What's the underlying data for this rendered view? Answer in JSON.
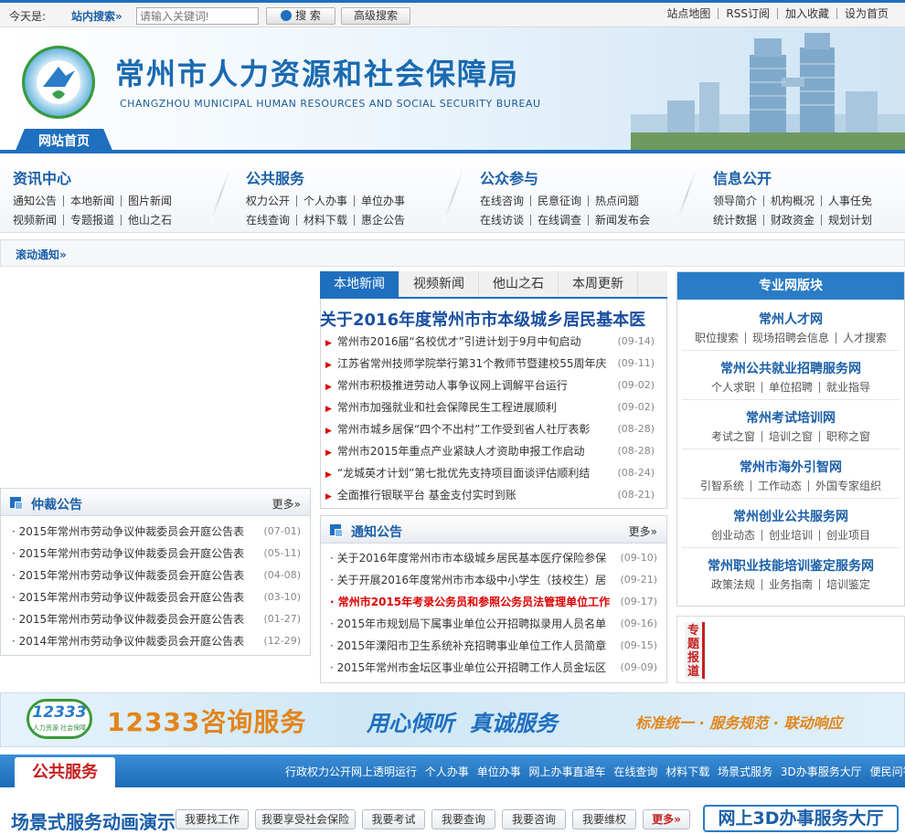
{
  "topbar": {
    "today_label": "今天是:",
    "search_label": "站内搜索",
    "search_placeholder": "请输入关键词!",
    "search_button": "搜 索",
    "advanced_button": "高级搜索",
    "links": [
      "站点地图",
      "RSS订阅",
      "加入收藏",
      "设为首页"
    ]
  },
  "banner": {
    "title": "常州市人力资源和社会保障局",
    "subtitle": "CHANGZHOU MUNICIPAL HUMAN RESOURCES AND SOCIAL SECURITY BUREAU",
    "home_tab": "网站首页"
  },
  "menus": [
    {
      "title": "资讯中心",
      "row1": [
        "通知公告",
        "本地新闻",
        "图片新闻"
      ],
      "row2": [
        "视频新闻",
        "专题报道",
        "他山之石"
      ]
    },
    {
      "title": "公共服务",
      "row1": [
        "权力公开",
        "个人办事",
        "单位办事"
      ],
      "row2": [
        "在线查询",
        "材料下载",
        "惠企公告"
      ]
    },
    {
      "title": "公众参与",
      "row1": [
        "在线咨询",
        "民意征询",
        "热点问题"
      ],
      "row2": [
        "在线访谈",
        "在线调查",
        "新闻发布会"
      ]
    },
    {
      "title": "信息公开",
      "row1": [
        "领导简介",
        "机构概况",
        "人事任免"
      ],
      "row2": [
        "统计数据",
        "财政资金",
        "规划计划"
      ]
    }
  ],
  "scroll_notice": "滚动通知",
  "arbitration": {
    "title": "仲裁公告",
    "more": "更多",
    "items": [
      {
        "text": "2015年常州市劳动争议仲裁委员会开庭公告表",
        "date": "(07-01)"
      },
      {
        "text": "2015年常州市劳动争议仲裁委员会开庭公告表",
        "date": "(05-11)"
      },
      {
        "text": "2015年常州市劳动争议仲裁委员会开庭公告表",
        "date": "(04-08)"
      },
      {
        "text": "2015年常州市劳动争议仲裁委员会开庭公告表",
        "date": "(03-10)"
      },
      {
        "text": "2015年常州市劳动争议仲裁委员会开庭公告表",
        "date": "(01-27)"
      },
      {
        "text": "2014年常州市劳动争议仲裁委员会开庭公告表",
        "date": "(12-29)"
      }
    ]
  },
  "news": {
    "tabs": [
      "本地新闻",
      "视频新闻",
      "他山之石",
      "本周更新"
    ],
    "headline": "关于2016年度常州市市本级城乡居民基本医",
    "items": [
      {
        "text": "常州市2016届“名校优才”引进计划于9月中旬启动",
        "date": "(09-14)"
      },
      {
        "text": "江苏省常州技师学院举行第31个教师节暨建校55周年庆",
        "date": "(09-11)"
      },
      {
        "text": "常州市积极推进劳动人事争议网上调解平台运行",
        "date": "(09-02)"
      },
      {
        "text": "常州市加强就业和社会保障民生工程进展顺利",
        "date": "(09-02)"
      },
      {
        "text": "常州市城乡居保“四个不出村”工作受到省人社厅表彰",
        "date": "(08-28)"
      },
      {
        "text": "常州市2015年重点产业紧缺人才资助申报工作启动",
        "date": "(08-28)"
      },
      {
        "text": "“龙城英才计划”第七批优先支持项目面谈评估顺利结",
        "date": "(08-24)"
      },
      {
        "text": "全面推行银联平台 基金支付实时到账",
        "date": "(08-21)"
      }
    ]
  },
  "notices": {
    "title": "通知公告",
    "more": "更多",
    "items": [
      {
        "text": "关于2016年度常州市市本级城乡居民基本医疗保险参保",
        "date": "(09-10)"
      },
      {
        "text": "关于开展2016年度常州市市本级中小学生（技校生）居",
        "date": "(09-21)"
      },
      {
        "text": "常州市2015年考录公务员和参照公务员法管理单位工作",
        "date": "(09-17)"
      },
      {
        "text": "2015年市规划局下属事业单位公开招聘拟录用人员名单",
        "date": "(09-16)"
      },
      {
        "text": "2015年溧阳市卫生系统补充招聘事业单位工作人员简章",
        "date": "(09-15)"
      },
      {
        "text": "2015年常州市金坛区事业单位公开招聘工作人员金坛区",
        "date": "(09-09)"
      }
    ]
  },
  "pro": {
    "title": "专业网版块",
    "items": [
      {
        "name": "常州人才网",
        "links": [
          "职位搜索",
          "现场招聘会信息",
          "人才搜索"
        ]
      },
      {
        "name": "常州公共就业招聘服务网",
        "links": [
          "个人求职",
          "单位招聘",
          "就业指导"
        ]
      },
      {
        "name": "常州考试培训网",
        "links": [
          "考试之窗",
          "培训之窗",
          "职称之窗"
        ]
      },
      {
        "name": "常州市海外引智网",
        "links": [
          "引智系统",
          "工作动态",
          "外国专家组织"
        ]
      },
      {
        "name": "常州创业公共服务网",
        "links": [
          "创业动态",
          "创业培训",
          "创业项目"
        ]
      },
      {
        "name": "常州职业技能培训鉴定服务网",
        "links": [
          "政策法规",
          "业务指南",
          "培训鉴定"
        ]
      }
    ]
  },
  "topic": {
    "label": "专题报道"
  },
  "b12333": {
    "logo_num": "12333",
    "logo_sub": "人力资源 社会保障",
    "title": "12333咨询服务",
    "slogan": "用心倾听  真诚服务",
    "motto": "标准统一 · 服务规范 · 联动响应"
  },
  "public_services": {
    "tab": "公共服务",
    "links": [
      "行政权力公开网上透明运行",
      "个人办事",
      "单位办事",
      "网上办事直通车",
      "在线查询",
      "材料下载",
      "场景式服务",
      "3D办事服务大厅",
      "便民问答"
    ]
  },
  "bottom": {
    "title": "场景式服务动画演示",
    "pills": [
      "我要找工作",
      "我要享受社会保险",
      "我要考试",
      "我要查询",
      "我要咨询",
      "我要维权"
    ],
    "more": "更多",
    "hall": "网上3D办事服务大厅"
  },
  "colors": {
    "brand": "#1f6fbf",
    "title": "#1a5fa8",
    "red": "#c51f1f"
  }
}
